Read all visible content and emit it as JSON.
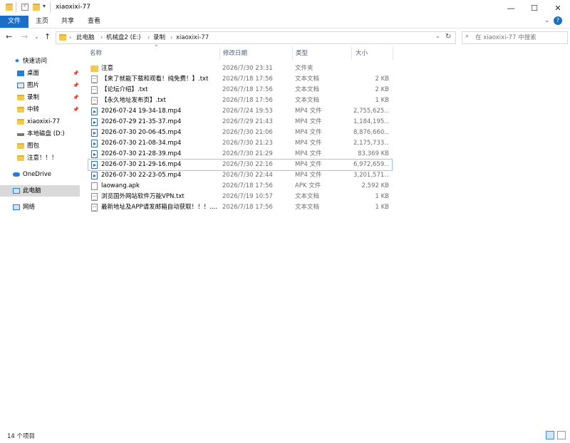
{
  "window": {
    "title": "xiaoxixi-77",
    "controls": {
      "minimize": "—",
      "maximize": "☐",
      "close": "✕"
    },
    "quick_access_toolbar_icons": [
      "folder-icon",
      "properties-icon",
      "new-folder-icon",
      "customize-dropdown-icon"
    ]
  },
  "ribbon": {
    "tabs": [
      "文件",
      "主页",
      "共享",
      "查看"
    ],
    "expand_icon": "chevron-down-icon",
    "help_icon": "help-icon"
  },
  "address": {
    "crumbs": [
      "此电脑",
      "机械盘2 (E:)",
      "录制",
      "xiaoxixi-77"
    ],
    "separator": "›",
    "refresh_icon": "refresh-icon"
  },
  "search": {
    "placeholder": "在 xiaoxixi-77 中搜索",
    "icon": "search-icon"
  },
  "nav": {
    "quick_access": "快速访问",
    "pinned": [
      {
        "label": "桌面",
        "icon": "desktop-icon"
      },
      {
        "label": "图片",
        "icon": "pictures-icon"
      },
      {
        "label": "录制",
        "icon": "folder-icon"
      },
      {
        "label": "中转",
        "icon": "folder-icon"
      }
    ],
    "recent": [
      {
        "label": "xiaoxixi-77",
        "icon": "folder-icon"
      },
      {
        "label": "本地磁盘 (D:)",
        "icon": "drive-icon"
      },
      {
        "label": "图包",
        "icon": "folder-icon"
      },
      {
        "label": "注意！！！",
        "icon": "folder-icon"
      }
    ],
    "onedrive": "OneDrive",
    "this_pc": "此电脑",
    "network": "网络"
  },
  "columns": {
    "name": "名称",
    "date": "修改日期",
    "type": "类型",
    "size": "大小"
  },
  "files": [
    {
      "name": "注意",
      "date": "2026/7/30 23:31",
      "type": "文件夹",
      "size": "",
      "icon": "folder"
    },
    {
      "name": "【来了就能下载和观看！纯免费！】.txt",
      "date": "2026/7/18 17:56",
      "type": "文本文档",
      "size": "2 KB",
      "icon": "doc"
    },
    {
      "name": "【论坛介绍】.txt",
      "date": "2026/7/18 17:56",
      "type": "文本文档",
      "size": "2 KB",
      "icon": "doc"
    },
    {
      "name": "【永久地址发布页】.txt",
      "date": "2026/7/18 17:56",
      "type": "文本文档",
      "size": "1 KB",
      "icon": "doc"
    },
    {
      "name": "2026-07-24 19-34-18.mp4",
      "date": "2026/7/24 19:53",
      "type": "MP4 文件",
      "size": "2,755,625...",
      "icon": "video"
    },
    {
      "name": "2026-07-29 21-35-37.mp4",
      "date": "2026/7/29 21:43",
      "type": "MP4 文件",
      "size": "1,184,195...",
      "icon": "video"
    },
    {
      "name": "2026-07-30 20-06-45.mp4",
      "date": "2026/7/30 21:06",
      "type": "MP4 文件",
      "size": "8,876,660...",
      "icon": "video"
    },
    {
      "name": "2026-07-30 21-08-34.mp4",
      "date": "2026/7/30 21:23",
      "type": "MP4 文件",
      "size": "2,175,733...",
      "icon": "video"
    },
    {
      "name": "2026-07-30 21-28-39.mp4",
      "date": "2026/7/30 21:29",
      "type": "MP4 文件",
      "size": "83,369 KB",
      "icon": "video"
    },
    {
      "name": "2026-07-30 21-29-16.mp4",
      "date": "2026/7/30 22:16",
      "type": "MP4 文件",
      "size": "6,972,659...",
      "icon": "video",
      "selected": true
    },
    {
      "name": "2026-07-30 22-23-05.mp4",
      "date": "2026/7/30 22:44",
      "type": "MP4 文件",
      "size": "3,201,571...",
      "icon": "video"
    },
    {
      "name": "laowang.apk",
      "date": "2026/7/18 17:56",
      "type": "APK 文件",
      "size": "2,592 KB",
      "icon": "apk"
    },
    {
      "name": "浏览国外网站软件万能VPN.txt",
      "date": "2026/7/19 10:57",
      "type": "文本文档",
      "size": "1 KB",
      "icon": "doc"
    },
    {
      "name": "最新地址及APP请发邮箱自动获取！！！....",
      "date": "2026/7/18 17:56",
      "type": "文本文档",
      "size": "1 KB",
      "icon": "doc"
    }
  ],
  "status": {
    "item_count": "14 个项目"
  },
  "colors": {
    "accent": "#1a6fc6",
    "selection_border": "#99c9ef",
    "folder": "#f2c94c"
  }
}
